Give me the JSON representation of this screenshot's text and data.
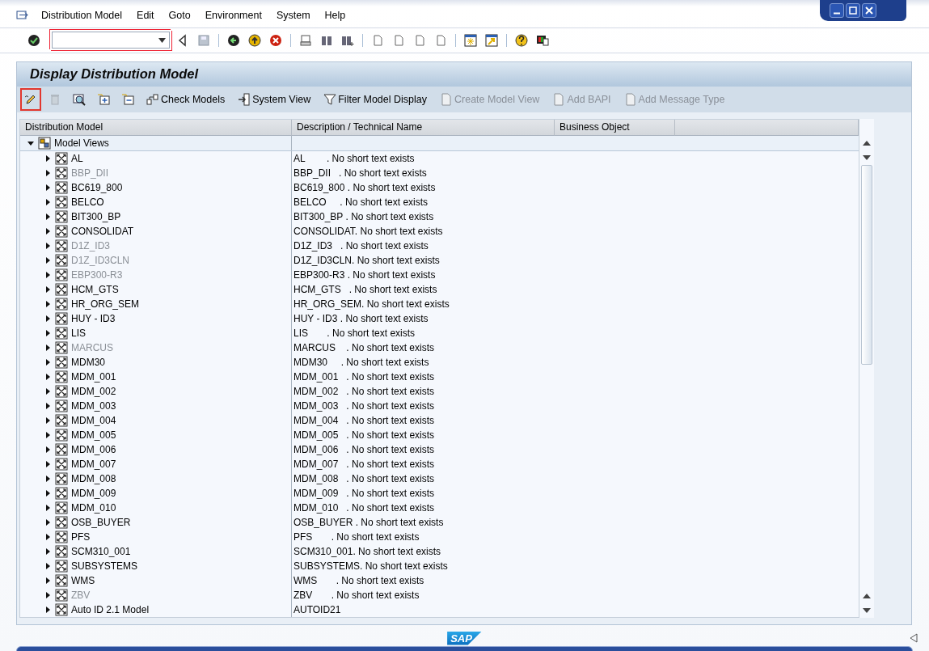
{
  "menu_bar": [
    {
      "label": "Distribution Model"
    },
    {
      "label": "Edit"
    },
    {
      "label": "Goto"
    },
    {
      "label": "Environment"
    },
    {
      "label": "System"
    },
    {
      "label": "Help"
    }
  ],
  "screen_title": "Display Distribution Model",
  "icon_buttons": [
    {
      "kind": "edit",
      "highlighted": true,
      "disabled": false
    },
    {
      "kind": "delete",
      "highlighted": false,
      "disabled": true
    },
    {
      "kind": "find",
      "highlighted": false,
      "disabled": false
    },
    {
      "kind": "expand",
      "highlighted": false,
      "disabled": false
    },
    {
      "kind": "collapse",
      "highlighted": false,
      "disabled": false
    }
  ],
  "app_toolbar": [
    {
      "kind": "check",
      "label": "Check Models",
      "disabled": false
    },
    {
      "kind": "system",
      "label": "System View",
      "disabled": false
    },
    {
      "kind": "filter",
      "label": "Filter Model Display",
      "disabled": false
    },
    {
      "kind": "doc",
      "label": "Create Model View",
      "disabled": true
    },
    {
      "kind": "doc",
      "label": "Add BAPI",
      "disabled": true
    },
    {
      "kind": "doc",
      "label": "Add Message Type",
      "disabled": true
    }
  ],
  "table": {
    "columns": [
      "Distribution Model",
      "Description / Technical Name",
      "Business Object"
    ],
    "root": {
      "label": "Model Views",
      "expanded": true,
      "children": [
        {
          "name": "AL",
          "description": "AL        . No short text exists",
          "expanded": false,
          "disabled": false
        },
        {
          "name": "BBP_DII",
          "description": "BBP_DII   . No short text exists",
          "expanded": false,
          "disabled": true
        },
        {
          "name": "BC619_800",
          "description": "BC619_800 . No short text exists",
          "expanded": false,
          "disabled": false
        },
        {
          "name": "BELCO",
          "description": "BELCO     . No short text exists",
          "expanded": false,
          "disabled": false
        },
        {
          "name": "BIT300_BP",
          "description": "BIT300_BP . No short text exists",
          "expanded": false,
          "disabled": false
        },
        {
          "name": "CONSOLIDAT",
          "description": "CONSOLIDAT. No short text exists",
          "expanded": false,
          "disabled": false
        },
        {
          "name": "D1Z_ID3",
          "description": "D1Z_ID3   . No short text exists",
          "expanded": false,
          "disabled": true
        },
        {
          "name": "D1Z_ID3CLN",
          "description": "D1Z_ID3CLN. No short text exists",
          "expanded": false,
          "disabled": true
        },
        {
          "name": "EBP300-R3",
          "description": "EBP300-R3 . No short text exists",
          "expanded": false,
          "disabled": true
        },
        {
          "name": "HCM_GTS",
          "description": "HCM_GTS   . No short text exists",
          "expanded": false,
          "disabled": false
        },
        {
          "name": "HR_ORG_SEM",
          "description": "HR_ORG_SEM. No short text exists",
          "expanded": false,
          "disabled": false
        },
        {
          "name": "HUY - ID3",
          "description": "HUY - ID3 . No short text exists",
          "expanded": false,
          "disabled": false
        },
        {
          "name": "LIS",
          "description": "LIS       . No short text exists",
          "expanded": false,
          "disabled": false
        },
        {
          "name": "MARCUS",
          "description": "MARCUS    . No short text exists",
          "expanded": false,
          "disabled": true
        },
        {
          "name": "MDM30",
          "description": "MDM30     . No short text exists",
          "expanded": false,
          "disabled": false
        },
        {
          "name": "MDM_001",
          "description": "MDM_001   . No short text exists",
          "expanded": false,
          "disabled": false
        },
        {
          "name": "MDM_002",
          "description": "MDM_002   . No short text exists",
          "expanded": false,
          "disabled": false
        },
        {
          "name": "MDM_003",
          "description": "MDM_003   . No short text exists",
          "expanded": false,
          "disabled": false
        },
        {
          "name": "MDM_004",
          "description": "MDM_004   . No short text exists",
          "expanded": false,
          "disabled": false
        },
        {
          "name": "MDM_005",
          "description": "MDM_005   . No short text exists",
          "expanded": false,
          "disabled": false
        },
        {
          "name": "MDM_006",
          "description": "MDM_006   . No short text exists",
          "expanded": false,
          "disabled": false
        },
        {
          "name": "MDM_007",
          "description": "MDM_007   . No short text exists",
          "expanded": false,
          "disabled": false
        },
        {
          "name": "MDM_008",
          "description": "MDM_008   . No short text exists",
          "expanded": false,
          "disabled": false
        },
        {
          "name": "MDM_009",
          "description": "MDM_009   . No short text exists",
          "expanded": false,
          "disabled": false
        },
        {
          "name": "MDM_010",
          "description": "MDM_010   . No short text exists",
          "expanded": false,
          "disabled": false
        },
        {
          "name": "OSB_BUYER",
          "description": "OSB_BUYER . No short text exists",
          "expanded": false,
          "disabled": false
        },
        {
          "name": "PFS",
          "description": "PFS       . No short text exists",
          "expanded": false,
          "disabled": false
        },
        {
          "name": "SCM310_001",
          "description": "SCM310_001. No short text exists",
          "expanded": false,
          "disabled": false
        },
        {
          "name": "SUBSYSTEMS",
          "description": "SUBSYSTEMS. No short text exists",
          "expanded": false,
          "disabled": false
        },
        {
          "name": "WMS",
          "description": "WMS       . No short text exists",
          "expanded": false,
          "disabled": false
        },
        {
          "name": "ZBV",
          "description": "ZBV       . No short text exists",
          "expanded": false,
          "disabled": true
        },
        {
          "name": "Auto ID 2.1 Model",
          "description": "AUTOID21",
          "expanded": false,
          "disabled": false
        }
      ]
    }
  },
  "footer": {
    "logo": "SAP"
  }
}
